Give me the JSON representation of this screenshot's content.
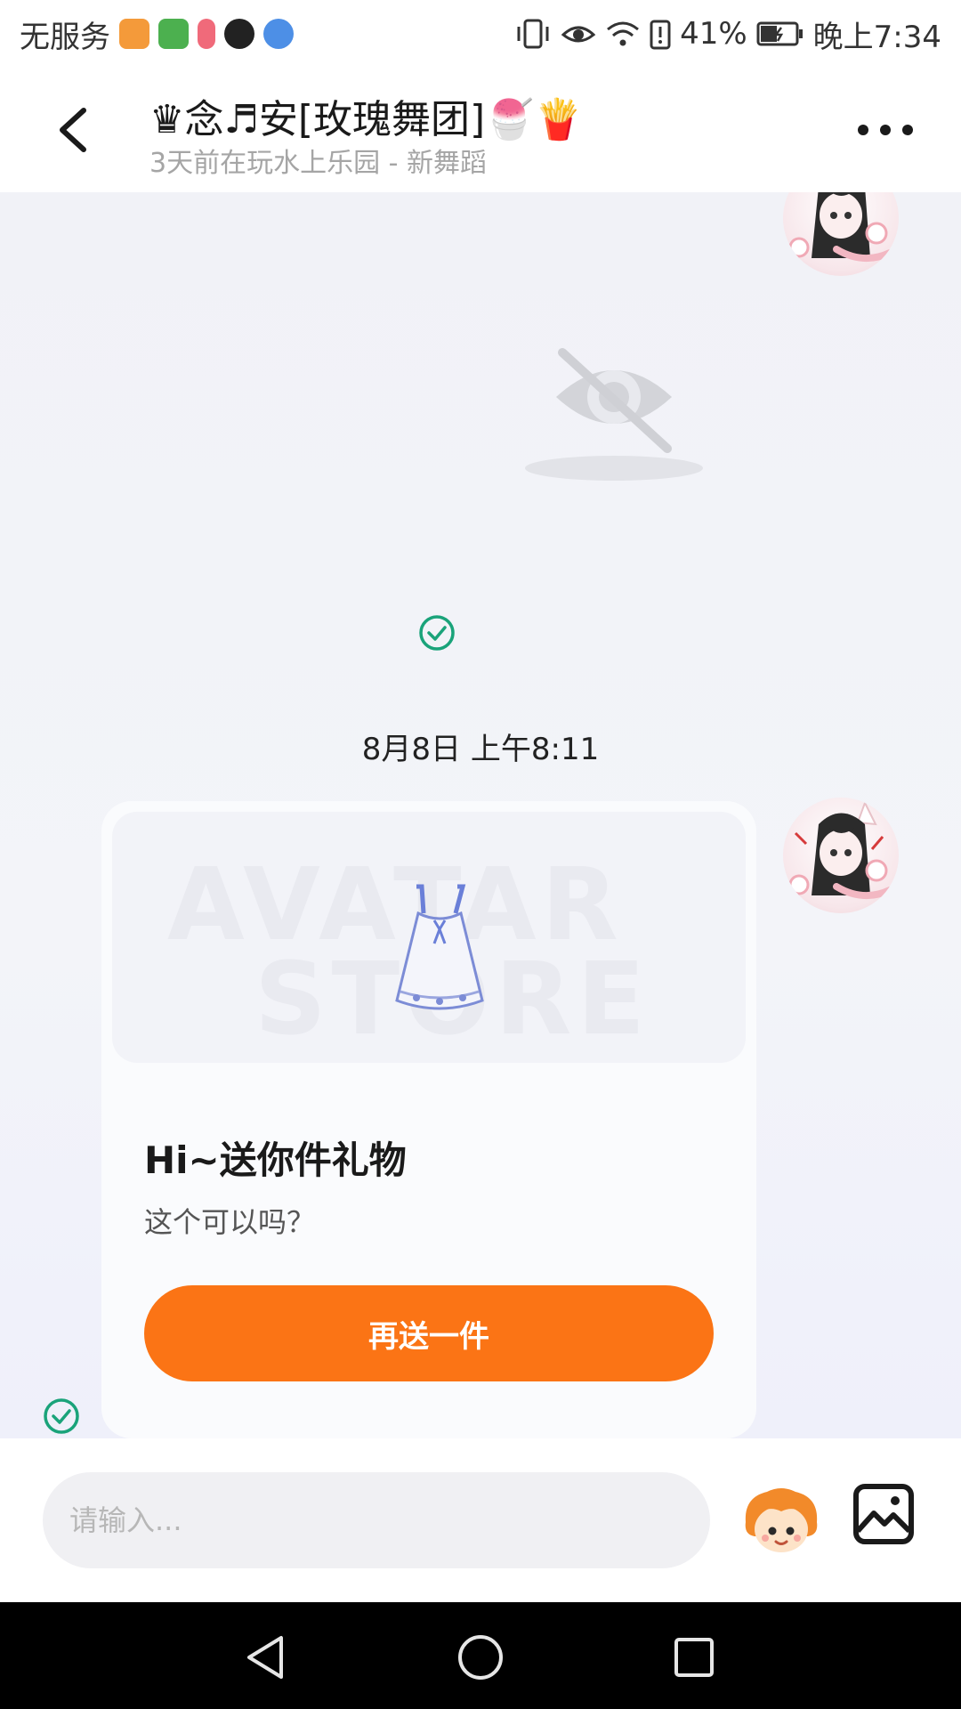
{
  "status_bar": {
    "carrier": "无服务",
    "battery": "41%",
    "time": "晚上7:34",
    "app_icon_colors": [
      "#f49a3a",
      "#4cb04f",
      "#f06a7a",
      "#222222",
      "#4d8fe6"
    ]
  },
  "header": {
    "title": "♛念♬安[玫瑰舞团]🍧🍟",
    "subtitle": "3天前在玩水上乐园 - 新舞蹈"
  },
  "chat": {
    "timestamp": "8月8日 上午8:11",
    "gift_card": {
      "watermark_line1": "AVATAR",
      "watermark_line2": "STORE",
      "title": "Hi~送你件礼物",
      "message": "这个可以吗？",
      "button_label": "再送一件"
    }
  },
  "input_bar": {
    "placeholder": "请输入..."
  },
  "colors": {
    "accent": "#fb7415",
    "check": "#1aa37a"
  }
}
